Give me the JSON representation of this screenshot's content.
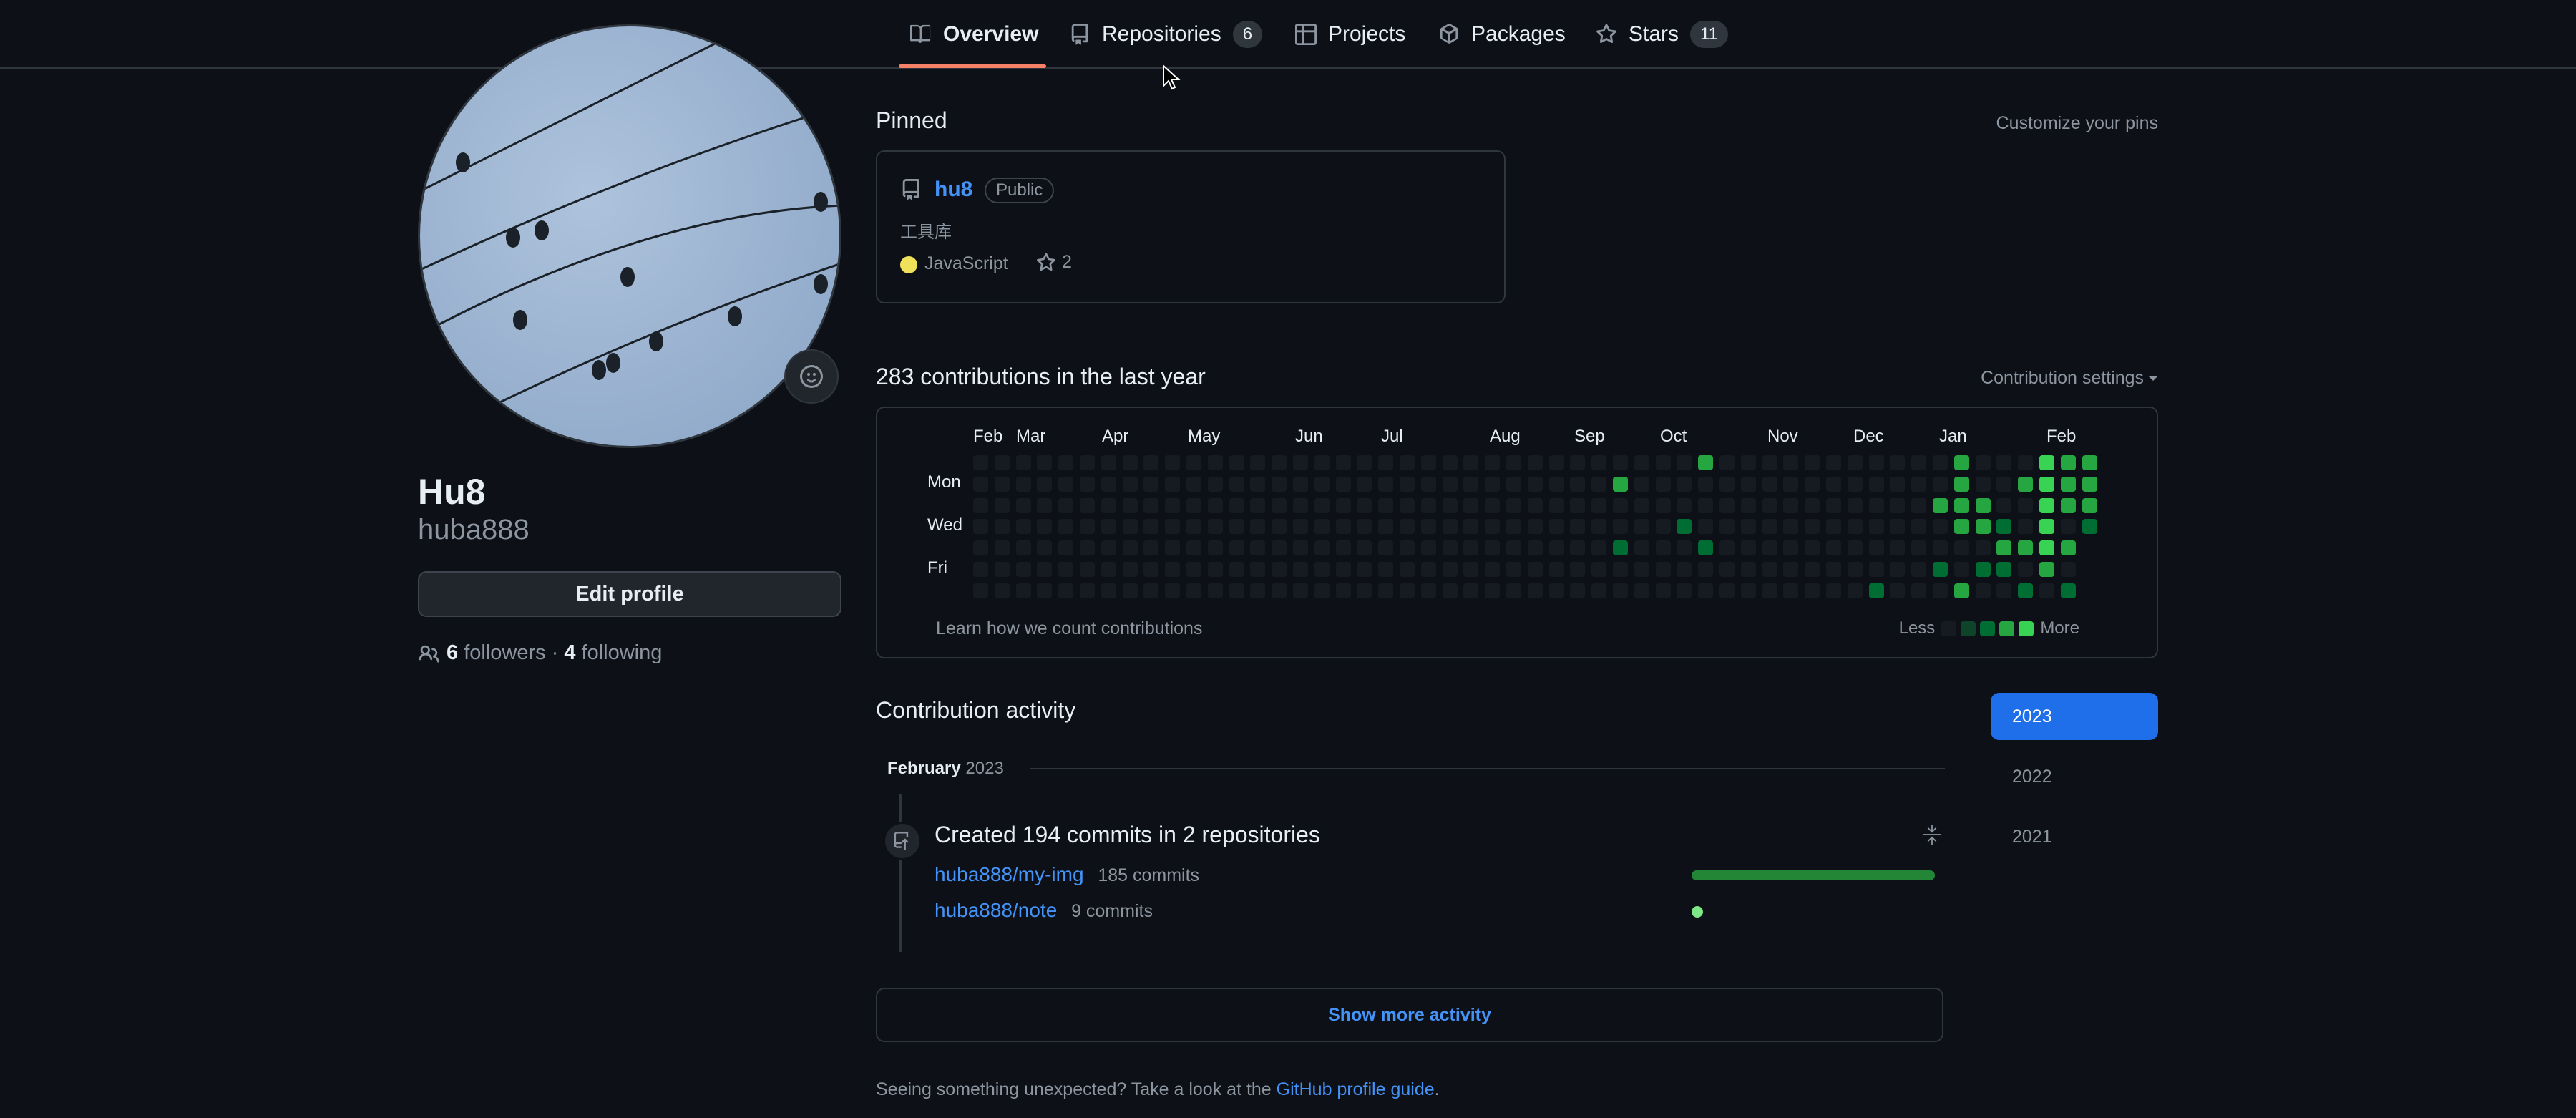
{
  "nav": {
    "tabs": [
      {
        "label": "Overview",
        "icon": "book-icon"
      },
      {
        "label": "Repositories",
        "count": "6",
        "icon": "repo-icon"
      },
      {
        "label": "Projects",
        "icon": "table-icon"
      },
      {
        "label": "Packages",
        "icon": "package-icon"
      },
      {
        "label": "Stars",
        "count": "11",
        "icon": "star-icon"
      }
    ],
    "selected": "Overview"
  },
  "profile": {
    "name": "Hu8",
    "login": "huba888",
    "edit_button": "Edit profile",
    "followers_count": "6",
    "followers_label": "followers",
    "separator": "·",
    "following_count": "4",
    "following_label": "following"
  },
  "pinned": {
    "title": "Pinned",
    "customize": "Customize your pins",
    "repo": {
      "name": "hu8",
      "visibility": "Public",
      "description": "工具库",
      "language": "JavaScript",
      "language_color": "#f1e05a",
      "stars": "2"
    }
  },
  "contributions": {
    "title": "283 contributions in the last year",
    "settings": "Contribution settings",
    "months": [
      "Feb",
      "Mar",
      "Apr",
      "May",
      "Jun",
      "Jul",
      "Aug",
      "Sep",
      "Oct",
      "Nov",
      "Dec",
      "Jan",
      "Feb"
    ],
    "days": [
      "Mon",
      "Wed",
      "Fri"
    ],
    "learn_link": "Learn how we count contributions",
    "legend_less": "Less",
    "legend_more": "More",
    "level_colors": [
      "#161b22",
      "#0e4429",
      "#006d32",
      "#26a641",
      "#39d353"
    ]
  },
  "activity": {
    "title": "Contribution activity",
    "period_month": "February",
    "period_year": "2023",
    "summary": "Created 194 commits in 2 repositories",
    "repos": [
      {
        "name": "huba888/my-img",
        "commits": "185 commits"
      },
      {
        "name": "huba888/note",
        "commits": "9 commits"
      }
    ],
    "show_more": "Show more activity"
  },
  "years": [
    "2023",
    "2022",
    "2021"
  ],
  "footer": {
    "text": "Seeing something unexpected? Take a look at the",
    "link": "GitHub profile guide",
    "end": "."
  }
}
